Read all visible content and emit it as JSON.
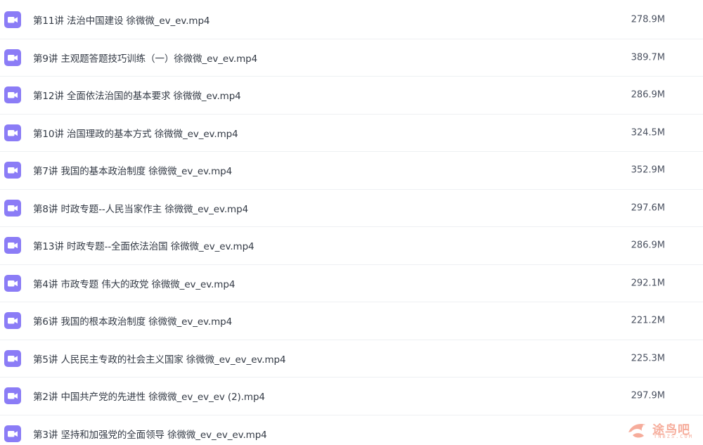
{
  "files": [
    {
      "name": "第11讲 法治中国建设 徐微微_ev_ev.mp4",
      "size": "278.9M",
      "icon": "video-file-icon"
    },
    {
      "name": "第9讲 主观题答题技巧训练（一）徐微微_ev_ev.mp4",
      "size": "389.7M",
      "icon": "video-file-icon"
    },
    {
      "name": "第12讲 全面依法治国的基本要求 徐微微_ev.mp4",
      "size": "286.9M",
      "icon": "video-file-icon"
    },
    {
      "name": "第10讲 治国理政的基本方式 徐微微_ev_ev.mp4",
      "size": "324.5M",
      "icon": "video-file-icon"
    },
    {
      "name": "第7讲 我国的基本政治制度 徐微微_ev_ev.mp4",
      "size": "352.9M",
      "icon": "video-file-icon"
    },
    {
      "name": "第8讲 时政专题--人民当家作主 徐微微_ev_ev.mp4",
      "size": "297.6M",
      "icon": "video-file-icon"
    },
    {
      "name": "第13讲 时政专题--全面依法治国 徐微微_ev_ev.mp4",
      "size": "286.9M",
      "icon": "video-file-icon"
    },
    {
      "name": "第4讲 市政专题 伟大的政党 徐微微_ev_ev.mp4",
      "size": "292.1M",
      "icon": "video-file-icon"
    },
    {
      "name": "第6讲 我国的根本政治制度 徐微微_ev_ev.mp4",
      "size": "221.2M",
      "icon": "video-file-icon"
    },
    {
      "name": "第5讲 人民民主专政的社会主义国家 徐微微_ev_ev_ev.mp4",
      "size": "225.3M",
      "icon": "video-file-icon"
    },
    {
      "name": "第2讲 中国共产党的先进性 徐微微_ev_ev_ev (2).mp4",
      "size": "297.9M",
      "icon": "video-file-icon"
    },
    {
      "name": "第3讲 坚持和加强党的全面领导 徐微微_ev_ev_ev.mp4",
      "size": "",
      "icon": "video-file-icon"
    }
  ],
  "watermark": {
    "text": "途鸟吧",
    "sub": "TNBZS.COM",
    "icon": "bird-logo-icon"
  },
  "colors": {
    "icon_bg": "#8b7cf6",
    "icon_glyph": "#ffffff",
    "row_divider": "#eef0f3",
    "text": "#333a45",
    "watermark": "#ef6a4a"
  }
}
